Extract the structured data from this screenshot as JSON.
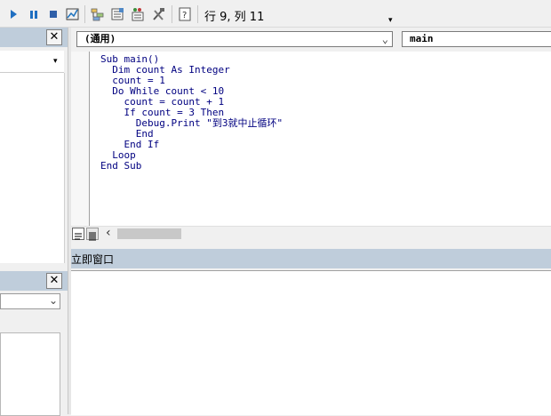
{
  "toolbar": {
    "position_status": "行 9, 列 11",
    "overflow_glyph": "▾",
    "icons": [
      "run-icon",
      "pause-icon",
      "reset-icon",
      "design-mode-icon",
      "project-explorer-icon",
      "properties-icon",
      "object-browser-icon",
      "toolbox-icon",
      "help-icon"
    ]
  },
  "project_pane": {
    "close_label": "✕",
    "dropdown_glyph": "▾"
  },
  "properties_pane": {
    "close_label": "✕",
    "dropdown_glyph": "⌄"
  },
  "code_window": {
    "object_combo": "(通用)",
    "procedure_combo": "main",
    "combo_arrow": "⌄",
    "lines": [
      "Sub main()",
      "  Dim count As Integer",
      "  count = 1",
      "  Do While count < 10",
      "    count = count + 1",
      "    If count = 3 Then",
      "      Debug.Print \"到3就中止循环\"",
      "      End",
      "    End If",
      "  Loop",
      "End Sub"
    ],
    "scroll_left_glyph": "‹"
  },
  "immediate_window": {
    "title": "立即窗口"
  },
  "colors": {
    "pane_header": "#bfcddb",
    "code_text": "#000080"
  }
}
